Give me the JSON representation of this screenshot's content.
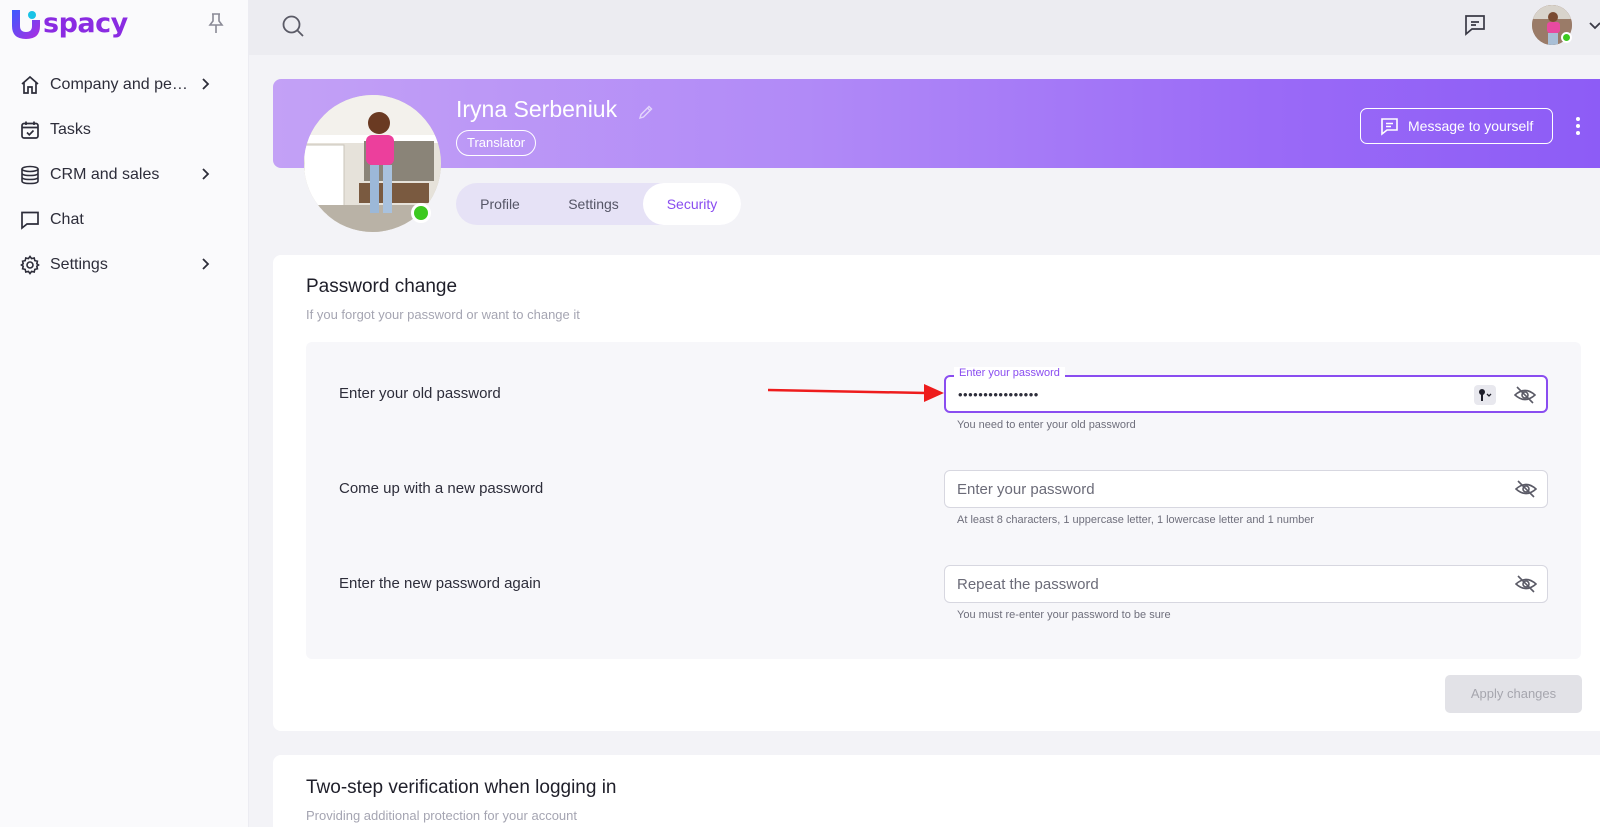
{
  "brand": {
    "name": "spacy",
    "accent": "#8a4df0"
  },
  "sidebar": {
    "items": [
      {
        "label": "Company and pe…",
        "icon": "home-icon",
        "has_submenu": true
      },
      {
        "label": "Tasks",
        "icon": "calendar-check-icon",
        "has_submenu": false
      },
      {
        "label": "CRM and sales",
        "icon": "database-icon",
        "has_submenu": true
      },
      {
        "label": "Chat",
        "icon": "chat-bubble-icon",
        "has_submenu": false
      },
      {
        "label": "Settings",
        "icon": "gear-icon",
        "has_submenu": true
      }
    ]
  },
  "profile": {
    "name": "Iryna Serbeniuk",
    "role": "Translator",
    "message_button": "Message to yourself",
    "tabs": [
      {
        "label": "Profile",
        "active": false
      },
      {
        "label": "Settings",
        "active": false
      },
      {
        "label": "Security",
        "active": true
      }
    ]
  },
  "password_change": {
    "title": "Password change",
    "subtitle": "If you forgot your password or want to change it",
    "old_password": {
      "label": "Enter your old password",
      "floating_label": "Enter your password",
      "value": "••••••••••••••••",
      "hint": "You need to enter your old password"
    },
    "new_password": {
      "label": "Come up with a new password",
      "placeholder": "Enter your password",
      "hint": "At least 8 characters, 1 uppercase letter, 1 lowercase letter and 1 number"
    },
    "repeat_password": {
      "label": "Enter the new password again",
      "placeholder": "Repeat the password",
      "hint": "You must re-enter your password to be sure"
    },
    "apply_button": "Apply changes"
  },
  "two_step": {
    "title": "Two-step verification when logging in",
    "subtitle": "Providing additional protection for your account"
  }
}
